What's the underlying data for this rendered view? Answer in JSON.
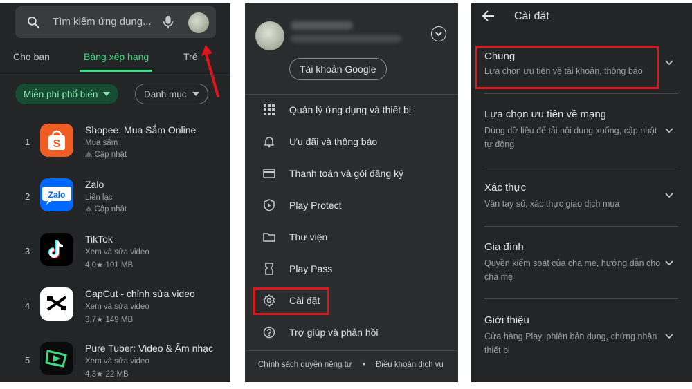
{
  "panel1": {
    "search": {
      "placeholder": "Tìm kiếm ứng dụng..."
    },
    "tabs": [
      "Cho bạn",
      "Bảng xếp hạng",
      "Trẻ"
    ],
    "chips": {
      "filter": "Miễn phí phổ biến",
      "category": "Danh mục"
    },
    "apps": [
      {
        "rank": "1",
        "name": "Shopee: Mua Sắm Online",
        "category": "Mua sắm",
        "meta": "Cập nhật",
        "icon": "shopee-icon",
        "color": "#f05d23"
      },
      {
        "rank": "2",
        "name": "Zalo",
        "category": "Liên lạc",
        "meta": "Cập nhật",
        "icon": "zalo-icon",
        "color": "#0068ff"
      },
      {
        "rank": "3",
        "name": "TikTok",
        "category": "Xem và sửa video",
        "meta": "4,0★ 101 MB",
        "icon": "tiktok-icon",
        "color": "#000000"
      },
      {
        "rank": "4",
        "name": "CapCut - chỉnh sửa video",
        "category": "Xem và sửa video",
        "meta": "3,7★ 149 MB",
        "icon": "capcut-icon",
        "color": "#ffffff"
      },
      {
        "rank": "5",
        "name": "Pure Tuber: Video & Âm nhạc",
        "category": "Xem và sửa video",
        "meta": "4,3★ 22 MB",
        "icon": "puretuber-icon",
        "color": "#0b0b0b"
      }
    ],
    "zalo_text": "Zalo",
    "arrow_color": "#e0141b"
  },
  "panel2": {
    "google_account_label": "Tài khoản Google",
    "menu": [
      {
        "label": "Quản lý ứng dụng và thiết bị",
        "icon": "grid-icon"
      },
      {
        "label": "Ưu đãi và thông báo",
        "icon": "bell-icon"
      },
      {
        "label": "Thanh toán và gói đăng ký",
        "icon": "card-icon"
      },
      {
        "label": "Play Protect",
        "icon": "shield-icon"
      },
      {
        "label": "Thư viện",
        "icon": "folder-icon"
      },
      {
        "label": "Play Pass",
        "icon": "ticket-icon"
      },
      {
        "label": "Cài đặt",
        "icon": "gear-icon"
      },
      {
        "label": "Trợ giúp và phản hồi",
        "icon": "help-icon"
      }
    ],
    "footer": {
      "privacy": "Chính sách quyền riêng tư",
      "dot": "•",
      "terms": "Điều khoản dịch vụ"
    }
  },
  "panel3": {
    "title": "Cài đặt",
    "sections": [
      {
        "title": "Chung",
        "desc": "Lựa chọn ưu tiên về tài khoản, thông báo"
      },
      {
        "title": "Lựa chọn ưu tiên về mạng",
        "desc": "Dùng dữ liệu để tải nội dung xuống, cập nhật tự động"
      },
      {
        "title": "Xác thực",
        "desc": "Vân tay số, xác thực giao dịch mua"
      },
      {
        "title": "Gia đình",
        "desc": "Quyền kiểm soát của cha mẹ, hướng dẫn cho cha mẹ"
      },
      {
        "title": "Giới thiệu",
        "desc": "Cửa hàng Play, phiên bản dụng, chứng nhận thiết bị"
      }
    ]
  },
  "colors": {
    "accent_green": "#3ddc84",
    "highlight_red": "#e0141b",
    "background": "#242526"
  }
}
